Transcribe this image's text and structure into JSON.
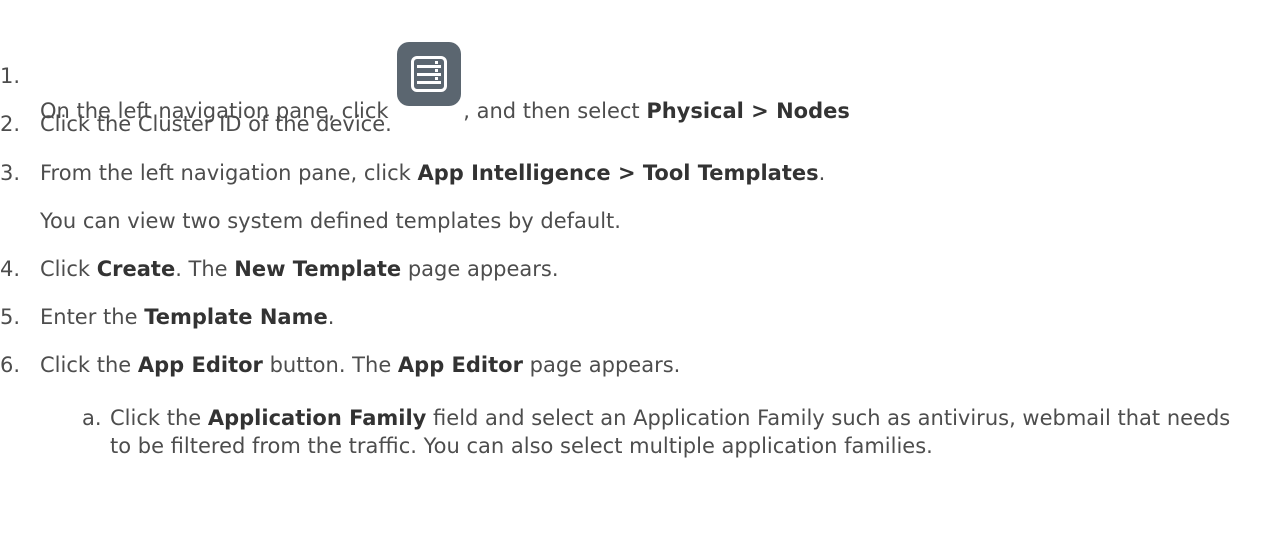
{
  "steps": [
    {
      "num": "1.",
      "a": "On the left navigation pane, click ",
      "b": ", and then select ",
      "c": "Physical > Nodes",
      "icon": "server-icon"
    },
    {
      "num": "2.",
      "a": "Click the Cluster ID of the device."
    },
    {
      "num": "3.",
      "a": "From the left navigation pane, click ",
      "b": "App Intelligence > Tool Templates",
      "c": ".",
      "note": "You can view two system defined templates by default."
    },
    {
      "num": "4.",
      "a": "Click ",
      "b": "Create",
      "c": ". The ",
      "d": "New Template",
      "e": " page appears."
    },
    {
      "num": "5.",
      "a": "Enter the ",
      "b": "Template Name",
      "c": "."
    },
    {
      "num": "6.",
      "a": "Click the ",
      "b": "App Editor",
      "c": " button. The ",
      "d": "App Editor",
      "e": " page appears."
    }
  ],
  "substeps": [
    {
      "num": "a.",
      "a": "Click the ",
      "b": "Application Family",
      "c": " field and select an Application Family such as antivirus, webmail that needs to be filtered from the traffic. You can also select multiple application families."
    }
  ],
  "colors": {
    "text": "#4d4d4d",
    "bold": "#333333",
    "icon_bg": "#5b6670"
  }
}
